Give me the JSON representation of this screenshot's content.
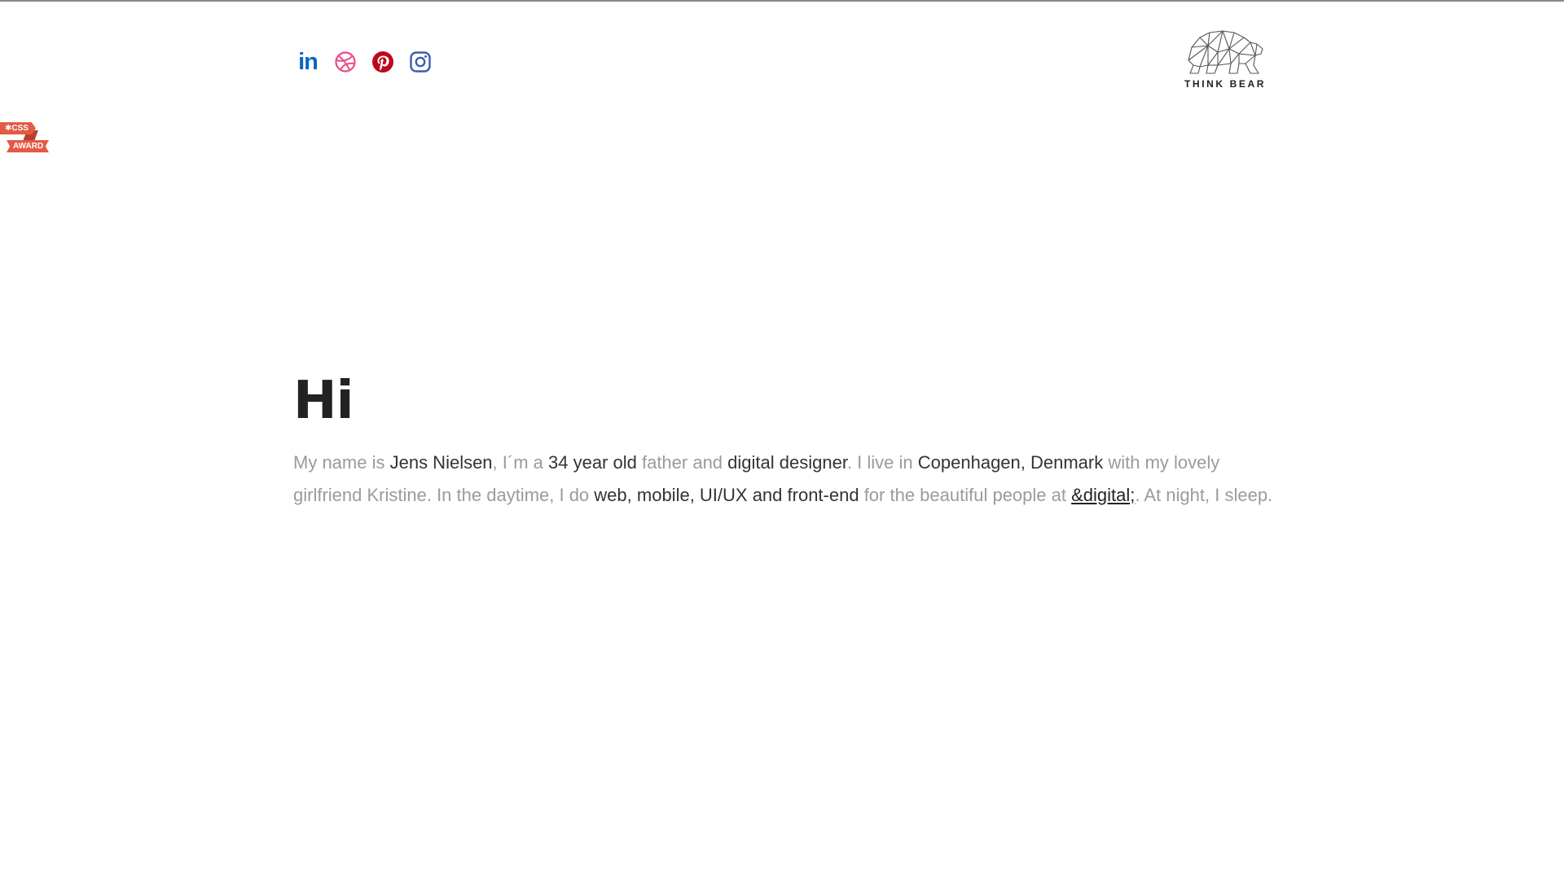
{
  "social": [
    {
      "name": "linkedin",
      "label": "in",
      "color": "#0a66c2"
    },
    {
      "name": "dribbble",
      "color": "#ea4c89"
    },
    {
      "name": "pinterest",
      "color": "#bd081c"
    },
    {
      "name": "instagram",
      "color": "#3b5db0"
    }
  ],
  "award": {
    "line1": "CSS",
    "line2": "AWARD",
    "color": "#e35a45"
  },
  "logo": {
    "text": "THINK BEAR"
  },
  "hero": {
    "title": "Hi",
    "bio": {
      "p1": "My name is ",
      "name": "Jens Nielsen",
      "p2": ", I´m a ",
      "age": "34 year old",
      "p3": " father and ",
      "role": "digital designer",
      "p4": ". I live in ",
      "location": "Copenhagen, Denmark",
      "p5": " with my lovely girlfriend Kristine. In the daytime, I do ",
      "skills": "web, mobile, UI/UX and front-end",
      "p6": " for the beautiful people at ",
      "company_link": "&digital;",
      "p7": ". At night, I sleep."
    }
  },
  "colors": {
    "muted_text": "#9b9b9b",
    "highlight_text": "#333333",
    "heading": "#222222"
  }
}
